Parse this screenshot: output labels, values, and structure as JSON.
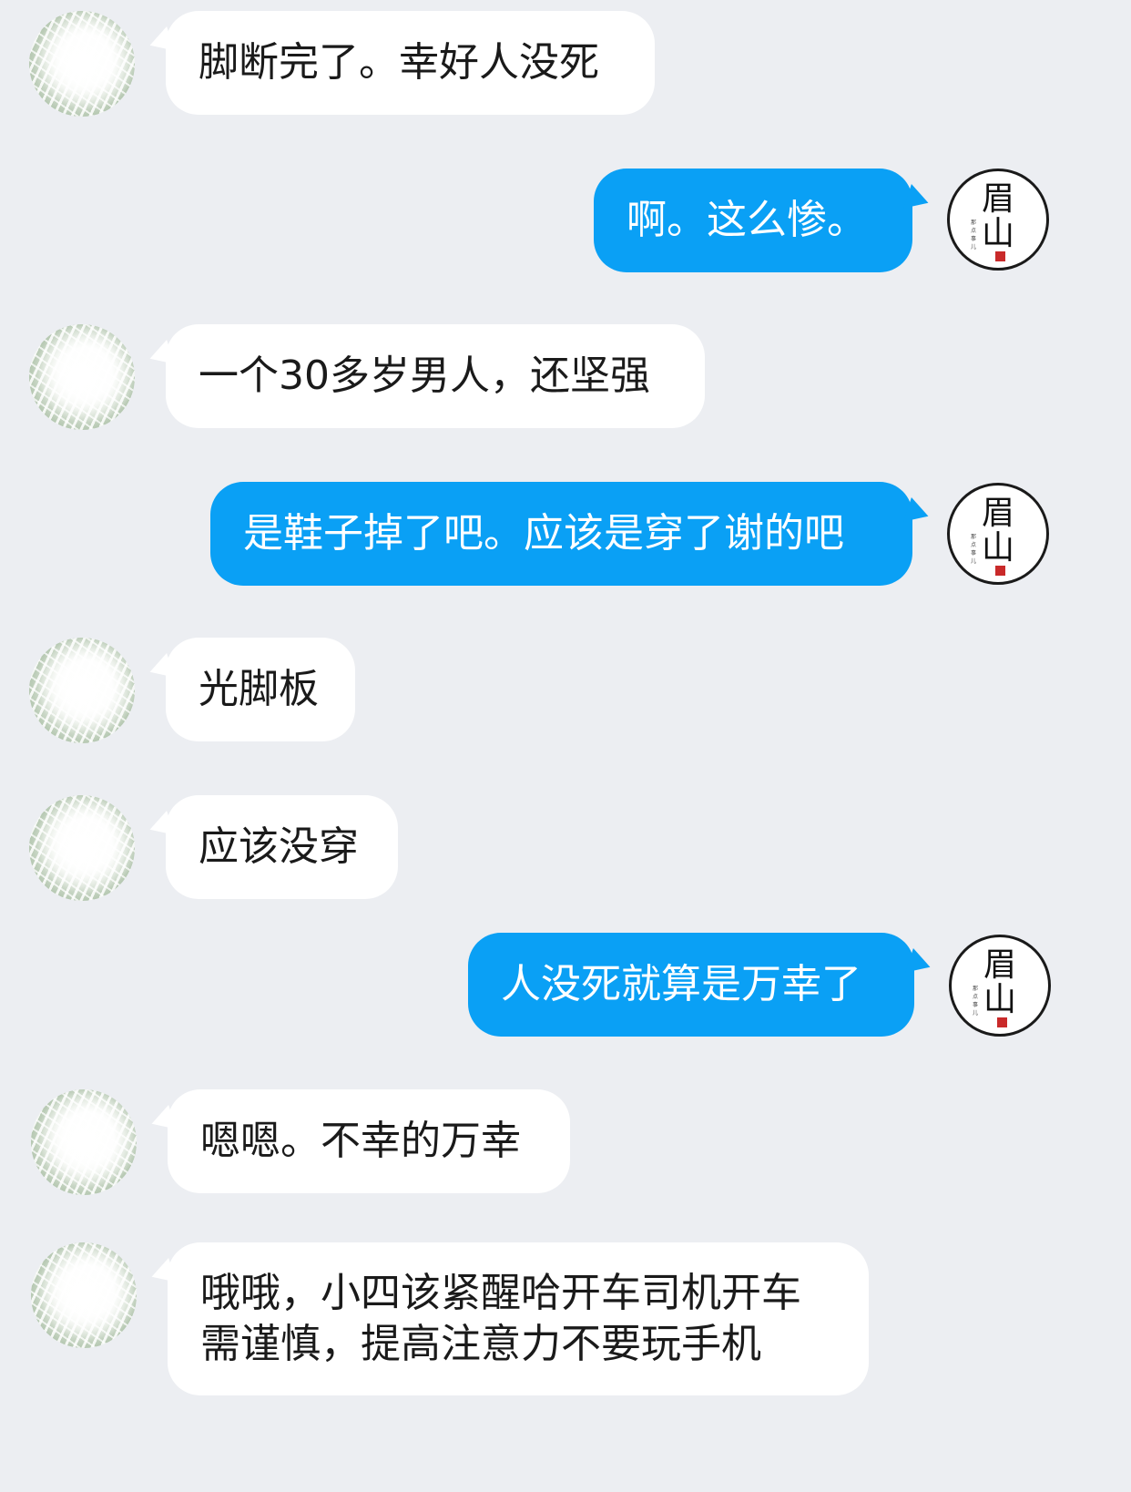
{
  "contact": {
    "avatar_icon": "blurred-photo-avatar"
  },
  "self": {
    "avatar_icon": "calligraphy-seal-avatar",
    "avatar_text_top": "眉",
    "avatar_text_bottom": "山",
    "avatar_small_text": "那点事儿"
  },
  "messages": [
    {
      "side": "left",
      "text": "脚断完了。幸好人没死"
    },
    {
      "side": "right",
      "text": "啊。这么惨。"
    },
    {
      "side": "left",
      "text": "一个30多岁男人，还坚强"
    },
    {
      "side": "right",
      "text": "是鞋子掉了吧。应该是穿了谢的吧"
    },
    {
      "side": "left",
      "text": "光脚板"
    },
    {
      "side": "left",
      "text": "应该没穿"
    },
    {
      "side": "right",
      "text": "人没死就算是万幸了"
    },
    {
      "side": "left",
      "text": "嗯嗯。不幸的万幸"
    },
    {
      "side": "left",
      "text": "哦哦，小四该紧醒哈开车司机开车需谨慎，提高注意力不要玩手机"
    }
  ],
  "colors": {
    "background": "#eceef2",
    "incoming_bubble": "#ffffff",
    "outgoing_bubble": "#0aa0f5",
    "outgoing_text": "#ffffff",
    "incoming_text": "#1a1a1a"
  }
}
